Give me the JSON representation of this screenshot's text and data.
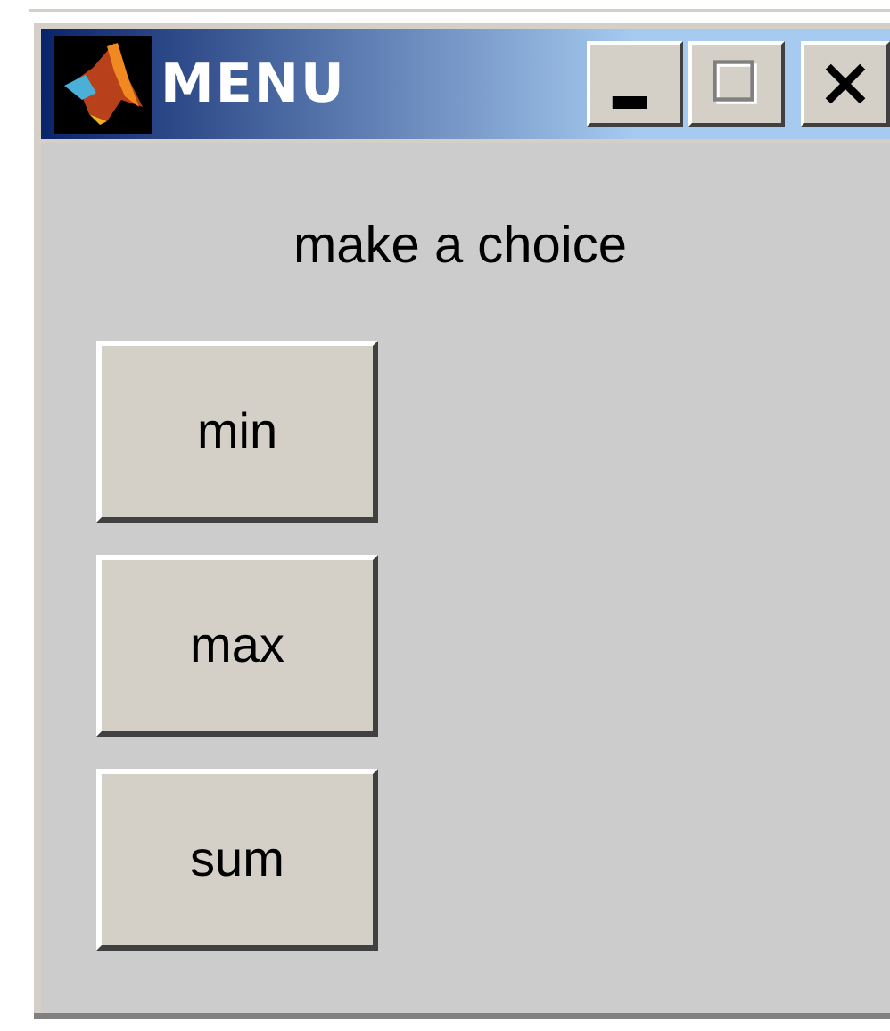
{
  "window": {
    "title": "MENU"
  },
  "prompt": "make a choice",
  "buttons": [
    {
      "label": "min"
    },
    {
      "label": "max"
    },
    {
      "label": "sum"
    }
  ]
}
